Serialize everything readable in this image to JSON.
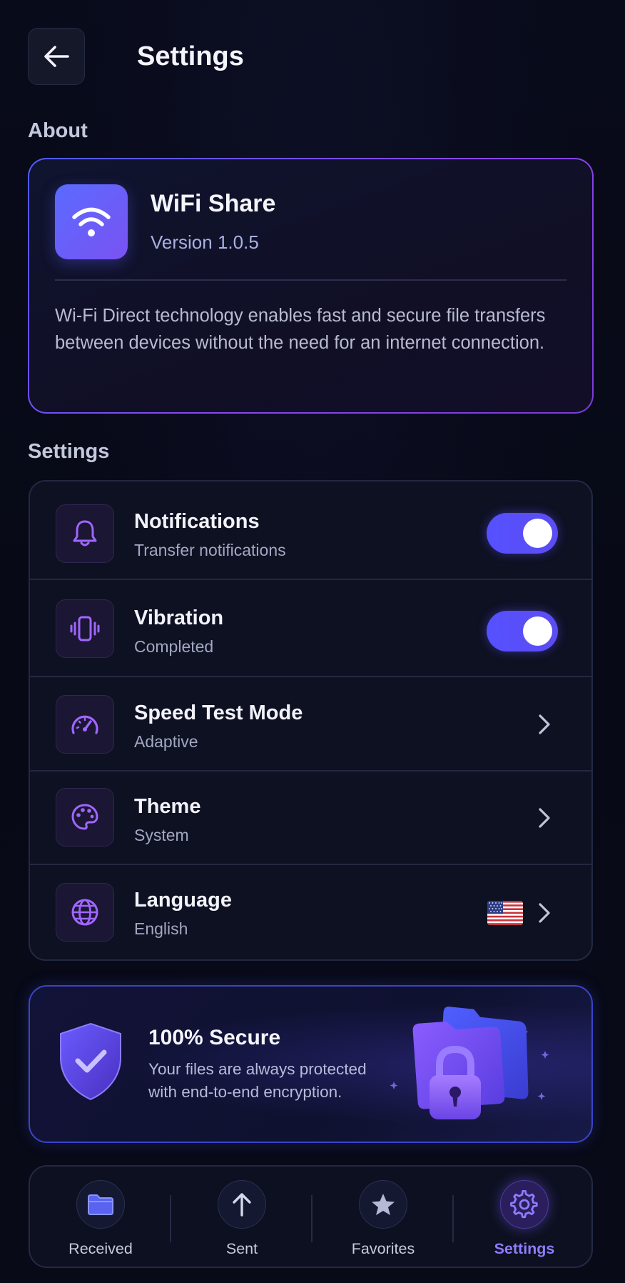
{
  "header": {
    "title": "Settings",
    "back_icon": "arrow-left-icon"
  },
  "about": {
    "section_label": "About",
    "app_name": "WiFi Share",
    "version": "Version 1.0.5",
    "description": "Wi-Fi Direct technology enables fast and secure file transfers between devices without the need for an internet connection.",
    "icon": "wifi-icon"
  },
  "settings": {
    "section_label": "Settings",
    "items": [
      {
        "title": "Notifications",
        "subtitle": "Transfer notifications",
        "icon": "bell-icon",
        "control": "toggle",
        "enabled": true
      },
      {
        "title": "Vibration",
        "subtitle": "Completed",
        "icon": "vibration-icon",
        "control": "toggle",
        "enabled": true
      },
      {
        "title": "Speed Test Mode",
        "subtitle": "Adaptive",
        "icon": "speedometer-icon",
        "control": "chevron"
      },
      {
        "title": "Theme",
        "subtitle": "System",
        "icon": "palette-icon",
        "control": "chevron"
      },
      {
        "title": "Language",
        "subtitle": "English",
        "icon": "globe-icon",
        "control": "chevron",
        "flag": "us-flag-icon"
      }
    ]
  },
  "secure": {
    "title": "100% Secure",
    "description": "Your files are always protected with end-to-end encryption.",
    "icon": "shield-check-icon",
    "illustration": "folder-lock-icon"
  },
  "nav": {
    "items": [
      {
        "label": "Received",
        "icon": "folder-icon",
        "active": false
      },
      {
        "label": "Sent",
        "icon": "arrow-up-icon",
        "active": false
      },
      {
        "label": "Favorites",
        "icon": "star-icon",
        "active": false
      },
      {
        "label": "Settings",
        "icon": "gear-icon",
        "active": true
      }
    ]
  },
  "colors": {
    "accent": "#5a55ff",
    "active_nav": "#8f7cff",
    "background": "#070a17"
  }
}
